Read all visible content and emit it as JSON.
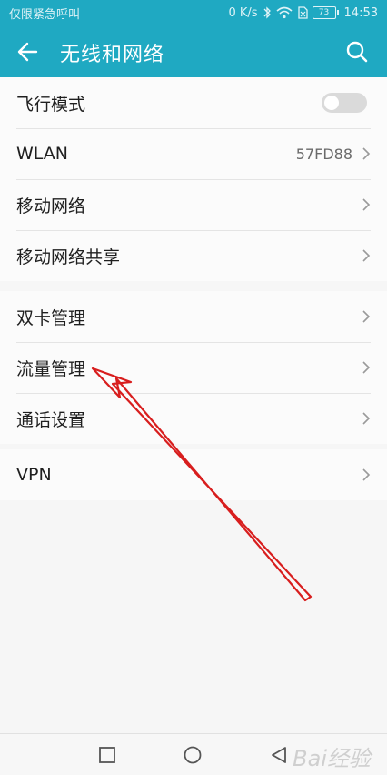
{
  "status_bar": {
    "carrier": "仅限紧急呼叫",
    "speed": "0 K/s",
    "battery": "73",
    "time": "14:53"
  },
  "toolbar": {
    "title": "无线和网络",
    "back_icon": "arrow-left-icon",
    "search_icon": "search-icon"
  },
  "group1": {
    "airplane_label": "飞行模式",
    "airplane_on": false,
    "wlan_label": "WLAN",
    "wlan_value": "57FD88",
    "mobile_network_label": "移动网络",
    "tethering_label": "移动网络共享"
  },
  "group2": {
    "dual_sim_label": "双卡管理",
    "data_usage_label": "流量管理",
    "call_settings_label": "通话设置"
  },
  "group3": {
    "vpn_label": "VPN"
  },
  "nav": {
    "recents_icon": "square-icon",
    "home_icon": "circle-icon",
    "back_icon": "triangle-back-icon"
  },
  "watermark": {
    "text": "Bai经验"
  },
  "colors": {
    "appbar": "#1fa9c2",
    "annotation_arrow": "#d81e1e"
  }
}
